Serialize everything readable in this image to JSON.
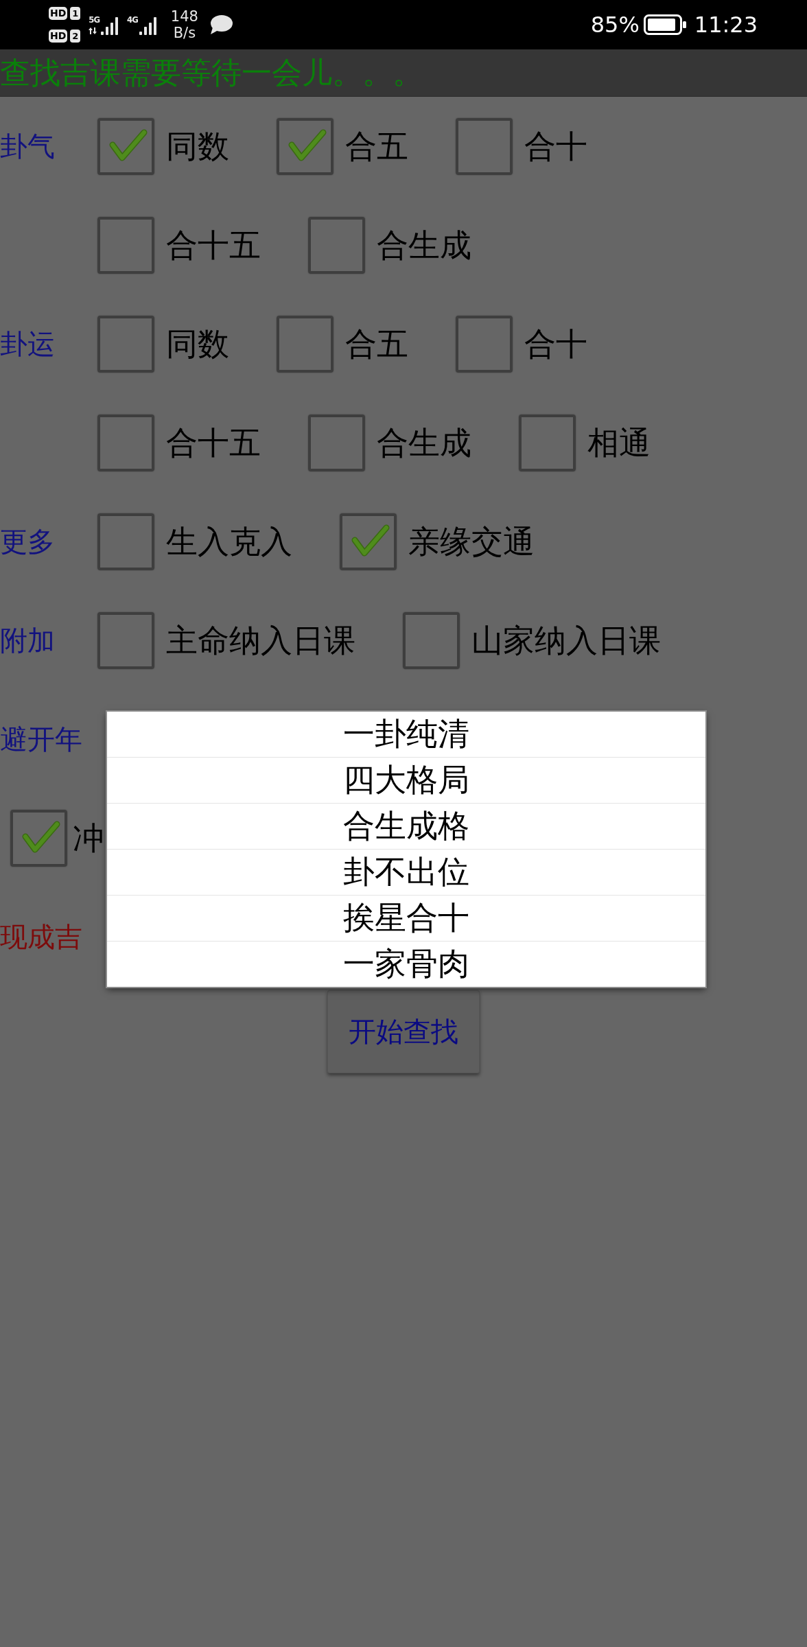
{
  "status_bar": {
    "sims": [
      {
        "badge": "HD",
        "slot": "1"
      },
      {
        "badge": "HD",
        "slot": "2"
      }
    ],
    "networks": [
      {
        "type": "5G",
        "data": true
      },
      {
        "type": "4G",
        "data": false
      }
    ],
    "speed_value": "148",
    "speed_unit": "B/s",
    "battery": "85%",
    "time": "11:23"
  },
  "title": "查找吉课需要等待一会儿。。。",
  "form": [
    {
      "kind": "options",
      "label": "卦气",
      "rows": [
        {
          "options": [
            {
              "label": "同数",
              "checked": true
            },
            {
              "label": "合五",
              "checked": true
            },
            {
              "label": "合十",
              "checked": false
            }
          ]
        },
        {
          "options": [
            {
              "label": "合十五",
              "checked": false
            },
            {
              "label": "合生成",
              "checked": false
            }
          ]
        }
      ]
    },
    {
      "kind": "options",
      "label": "卦运",
      "rows": [
        {
          "options": [
            {
              "label": "同数",
              "checked": false
            },
            {
              "label": "合五",
              "checked": false
            },
            {
              "label": "合十",
              "checked": false
            }
          ]
        },
        {
          "options": [
            {
              "label": "合十五",
              "checked": false
            },
            {
              "label": "合生成",
              "checked": false
            },
            {
              "label": "相通",
              "checked": false
            }
          ]
        }
      ]
    },
    {
      "kind": "options",
      "label": "更多",
      "rows": [
        {
          "options": [
            {
              "label": "生入克入",
              "checked": false
            },
            {
              "label": "亲缘交通",
              "checked": true
            }
          ]
        }
      ]
    },
    {
      "kind": "options",
      "label": "附加",
      "rows": [
        {
          "options": [
            {
              "label": "主命纳入日课",
              "checked": false
            },
            {
              "label": "山家纳入日课",
              "checked": false
            }
          ]
        }
      ]
    },
    {
      "kind": "heading",
      "label": "避开年"
    },
    {
      "kind": "options",
      "rows": [
        {
          "options": [
            {
              "label": "冲",
              "checked": true
            }
          ]
        }
      ]
    },
    {
      "kind": "note",
      "label": "现成吉"
    }
  ],
  "search_button": "开始查找",
  "dialog": {
    "items": [
      "一卦纯清",
      "四大格局",
      "合生成格",
      "卦不出位",
      "挨星合十",
      "一家骨肉"
    ]
  }
}
